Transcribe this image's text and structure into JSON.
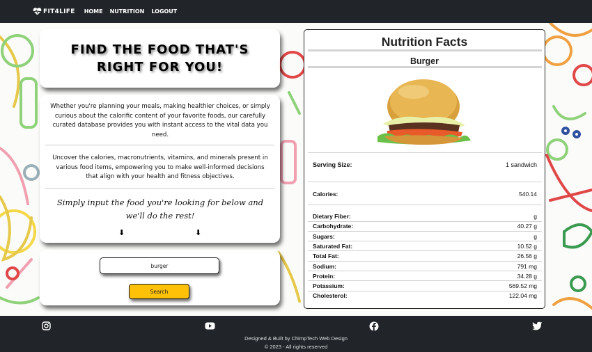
{
  "navbar": {
    "brand": "FIT4LIFE",
    "links": [
      "HOME",
      "NUTRITION",
      "LOGOUT"
    ]
  },
  "hero": {
    "title": "FIND THE FOOD THAT'S RIGHT FOR YOU!"
  },
  "info": {
    "paragraph1": "Whether you're planning your meals, making healthier choices, or simply curious about the calorific content of your favorite foods, our carefully curated database provides you with instant access to the vital data you need.",
    "paragraph2": "Uncover the calories, macronutrients, vitamins, and minerals present in various food items, empowering you to make well-informed decisions that align with your health and fitness objectives.",
    "prompt": "Simply input the food you're looking for below and we'll do the rest!",
    "arrow": "⬇"
  },
  "search": {
    "value": "burger",
    "button_label": "Search"
  },
  "facts": {
    "title": "Nutrition Facts",
    "food_name": "Burger",
    "serving_label": "Serving Size:",
    "serving_value": "1 sandwich",
    "calories_label": "Calories:",
    "calories_value": "540.14",
    "nutrients": [
      {
        "label": "Dietary Fiber:",
        "value": "g"
      },
      {
        "label": "Carbohydrate:",
        "value": "40.27 g"
      },
      {
        "label": "Sugars:",
        "value": "g"
      },
      {
        "label": "Saturated Fat:",
        "value": "10.52 g"
      },
      {
        "label": "Total Fat:",
        "value": "26.56 g"
      },
      {
        "label": "Sodium:",
        "value": "791 mg"
      },
      {
        "label": "Protein:",
        "value": "34.28 g"
      },
      {
        "label": "Potassium:",
        "value": "569.52 mg"
      },
      {
        "label": "Cholesterol:",
        "value": "122.04 mg"
      }
    ]
  },
  "footer": {
    "credit": "Designed & Built by ChimpTech Web Design",
    "copyright": "© 2023 - All rights reserved",
    "social_icons": [
      "instagram-icon",
      "youtube-icon",
      "facebook-icon",
      "twitter-icon"
    ]
  },
  "colors": {
    "navbar_bg": "#212529",
    "search_button": "#ffc107"
  }
}
